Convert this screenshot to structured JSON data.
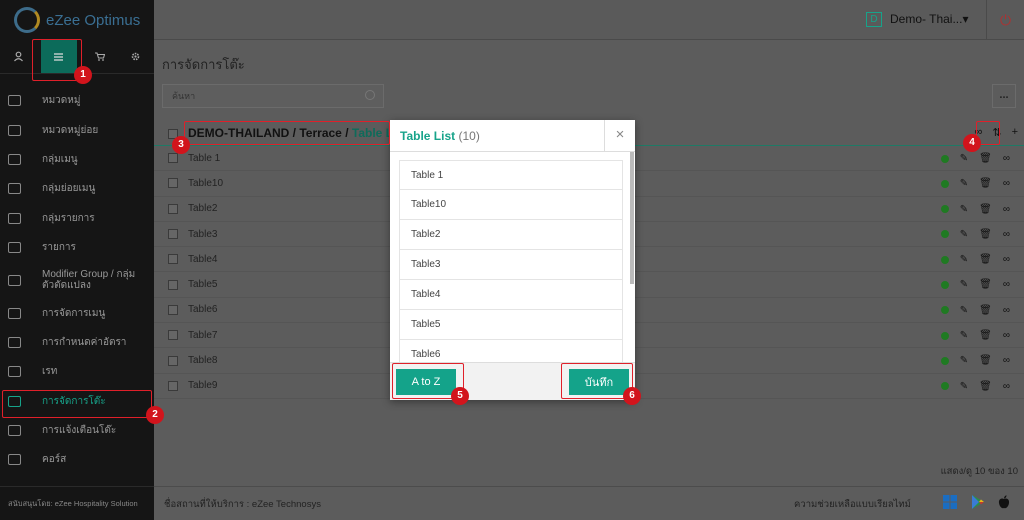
{
  "brand": {
    "name": "eZee Optimus"
  },
  "sidebar": {
    "tab_icons": [
      "user-icon",
      "menu-icon",
      "cart-icon",
      "gear-icon"
    ],
    "items": [
      {
        "label": "หมวดหมู่"
      },
      {
        "label": "หมวดหมู่ย่อย"
      },
      {
        "label": "กลุ่มเมนู"
      },
      {
        "label": "กลุ่มย่อยเมนู"
      },
      {
        "label": "กลุ่มรายการ"
      },
      {
        "label": "รายการ"
      },
      {
        "label": "Modifier Group / กลุ่มตัวตัดแปลง"
      },
      {
        "label": "การจัดการเมนู"
      },
      {
        "label": "การกำหนดค่าอัตรา"
      },
      {
        "label": "เรท"
      },
      {
        "label": "การจัดการโต๊ะ"
      },
      {
        "label": "การแจ้งเตือนโต๊ะ"
      },
      {
        "label": "คอร์ส"
      }
    ],
    "footer": "สนับสนุนโดย: eZee Hospitality Solution"
  },
  "topbar": {
    "property_badge": "D",
    "property_name": "Demo- Thai...▾",
    "power_glyph": "⏻"
  },
  "page": {
    "title": "การจัดการโต๊ะ",
    "search_placeholder": "ค้นหา",
    "more_label": "...",
    "breadcrumb": {
      "root": "DEMO-THAILAND",
      "sep1": "/",
      "area": "Terrace",
      "sep2": "/",
      "current": "Table Li"
    },
    "header_icons": [
      "link-icon",
      "sort-icon",
      "plus-icon"
    ],
    "tables": [
      "Table 1",
      "Table10",
      "Table2",
      "Table3",
      "Table4",
      "Table5",
      "Table6",
      "Table7",
      "Table8",
      "Table9"
    ],
    "pager": "แสดง/ดู 10 ของ 10"
  },
  "footer": {
    "left": "ชื่อสถานที่ให้บริการ : eZee Technosys",
    "help": "ความช่วยเหลือแบบเรียลไทม์"
  },
  "modal": {
    "title": "Table List",
    "count": "(10)",
    "close": "×",
    "items": [
      "Table 1",
      "Table10",
      "Table2",
      "Table3",
      "Table4",
      "Table5",
      "Table6"
    ],
    "atoz_label": "A to Z",
    "save_label": "บันทึก"
  },
  "annotations": [
    "1",
    "2",
    "3",
    "4",
    "5",
    "6"
  ],
  "colors": {
    "accent": "#14a38a",
    "highlight": "#e0202a",
    "marker": "#d2141c"
  }
}
